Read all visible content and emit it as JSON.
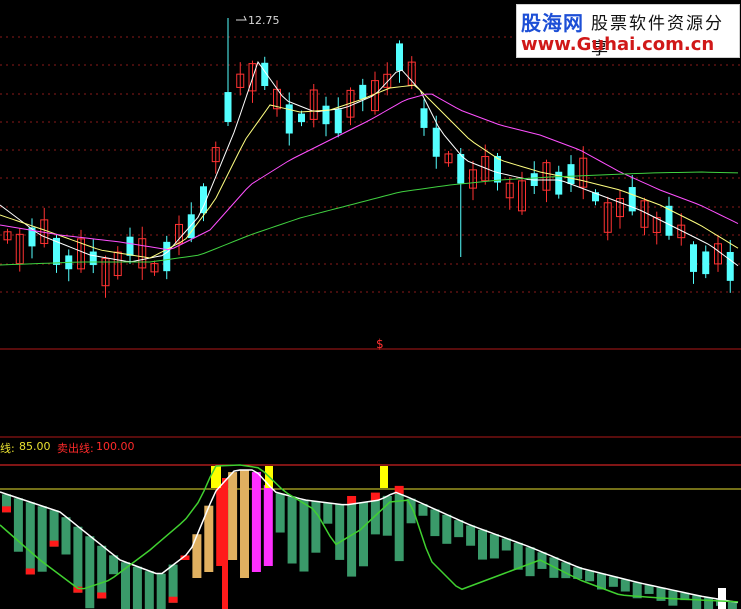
{
  "watermark": {
    "site_name": "股海网",
    "slogan": "股票软件资源分享",
    "url": "www.Guhai.com.cn"
  },
  "chart_labels": {
    "peak_price": "12.75",
    "marker": "$"
  },
  "indicator_legend": {
    "buy_line_name": "线:",
    "buy_line_value": "85.00",
    "sell_line_name": "卖出线:",
    "sell_line_value": "100.00"
  },
  "colors": {
    "background": "#000000",
    "grid": "#8a1a1a",
    "candle_up": "#ff3232",
    "candle_down": "#54ffff",
    "ma_short": "#ffffff",
    "ma_mid": "#ffff80",
    "ma_long": "#ff50ff",
    "ma_longest": "#40d040",
    "panel_divider": "#b01818",
    "sell_line": "#ff2a2a",
    "buy_line": "#e8e030",
    "hist_green": "#3a9a6a",
    "hist_red": "#ff1a1a",
    "hist_tan": "#e0b060",
    "hist_magenta": "#ff30ff",
    "hist_yellow": "#ffff00",
    "oscillator": "#40d030",
    "smooth_line": "#ffffff"
  },
  "chart_data": [
    {
      "type": "candlestick",
      "title": "",
      "annotations": [
        "12.75"
      ],
      "grid": true,
      "series": [
        {
          "name": "",
          "type": "candlestick"
        },
        {
          "name": "",
          "type": "line"
        },
        {
          "name": "",
          "type": "line"
        },
        {
          "name": "",
          "type": "line"
        },
        {
          "name": "",
          "type": "line"
        }
      ]
    },
    {
      "type": "bar",
      "title": "",
      "reference_lines": [
        85.0,
        100.0
      ],
      "legend": [
        "线: 85.00",
        "卖出线: 100.00"
      ]
    }
  ]
}
